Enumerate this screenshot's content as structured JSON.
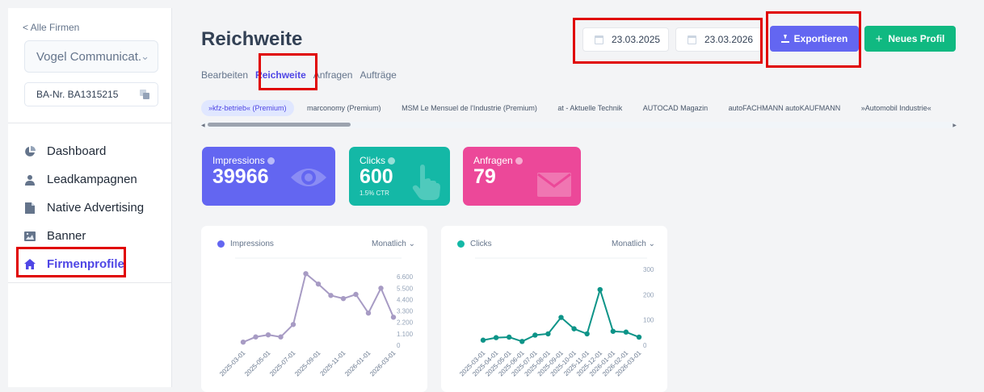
{
  "sidebar": {
    "back_link": "< Alle Firmen",
    "company": "Vogel Communicat...",
    "ba_nr": "BA-Nr. BA1315215",
    "items": [
      {
        "label": "Dashboard",
        "icon": "pie-chart-icon"
      },
      {
        "label": "Leadkampagnen",
        "icon": "user-icon"
      },
      {
        "label": "Native Advertising",
        "icon": "document-icon"
      },
      {
        "label": "Banner",
        "icon": "image-icon"
      },
      {
        "label": "Firmenprofile",
        "icon": "home-icon",
        "active": true
      }
    ]
  },
  "header": {
    "title": "Reichweite",
    "tabs": [
      "Bearbeiten",
      "Reichweite",
      "Anfragen",
      "Aufträge"
    ],
    "active_tab": "Reichweite",
    "date_from": "23.03.2025",
    "date_to": "23.03.2026",
    "export_label": "Exportieren",
    "new_profile_label": "Neues Profil"
  },
  "profiles": [
    "»kfz-betrieb« (Premium)",
    "marconomy (Premium)",
    "MSM Le Mensuel de l'Industrie (Premium)",
    "at - Aktuelle Technik",
    "AUTOCAD Magazin",
    "autoFACHMANN autoKAUFMANN",
    "»Automobil Industrie«"
  ],
  "stats": {
    "impressions": {
      "label": "Impressions",
      "value": "39966",
      "color": "#6366f1"
    },
    "clicks": {
      "label": "Clicks",
      "value": "600",
      "sub": "1.5% CTR",
      "color": "#14b8a6"
    },
    "anfragen": {
      "label": "Anfragen",
      "value": "79",
      "color": "#ec4899"
    }
  },
  "chart_data": [
    {
      "type": "line",
      "series": [
        {
          "name": "Impressions",
          "color": "#a79bc4",
          "values": [
            300,
            800,
            1000,
            800,
            2000,
            6900,
            5900,
            4800,
            4500,
            4900,
            3100,
            5500,
            2700
          ]
        }
      ],
      "x": [
        "2025-03-01",
        "2025-04-01",
        "2025-05-01",
        "2025-06-01",
        "2025-07-01",
        "2025-08-01",
        "2025-09-01",
        "2025-10-01",
        "2025-11-01",
        "2025-12-01",
        "2026-01-01",
        "2026-02-01",
        "2026-03-01"
      ],
      "xticks": [
        "2025-03-01",
        "2025-05-01",
        "2025-07-01",
        "2025-09-01",
        "2025-11-01",
        "2026-01-01",
        "2026-03-01"
      ],
      "yticks": [
        "0",
        "1.100",
        "2.200",
        "3.300",
        "4.400",
        "5.500",
        "6.600"
      ],
      "ylim": [
        0,
        7000
      ],
      "period": "Monatlich",
      "legend_dot": "#6366f1"
    },
    {
      "type": "line",
      "series": [
        {
          "name": "Clicks",
          "color": "#0d9488",
          "values": [
            20,
            30,
            32,
            15,
            40,
            45,
            110,
            65,
            45,
            220,
            55,
            52,
            32
          ]
        }
      ],
      "x": [
        "2025-03-01",
        "2025-04-01",
        "2025-05-01",
        "2025-06-01",
        "2025-07-01",
        "2025-08-01",
        "2025-09-01",
        "2025-10-01",
        "2025-11-01",
        "2025-12-01",
        "2026-01-01",
        "2026-02-01",
        "2026-03-01"
      ],
      "xticks": [
        "2025-03-01",
        "2025-04-01",
        "2025-05-01",
        "2025-06-01",
        "2025-07-01",
        "2025-08-01",
        "2025-09-01",
        "2025-10-01",
        "2025-11-01",
        "2025-12-01",
        "2026-01-01",
        "2026-02-01",
        "2026-03-01"
      ],
      "yticks": [
        "0",
        "100",
        "200",
        "300"
      ],
      "ylim": [
        0,
        300
      ],
      "period": "Monatlich",
      "legend_dot": "#14b8a6"
    }
  ]
}
